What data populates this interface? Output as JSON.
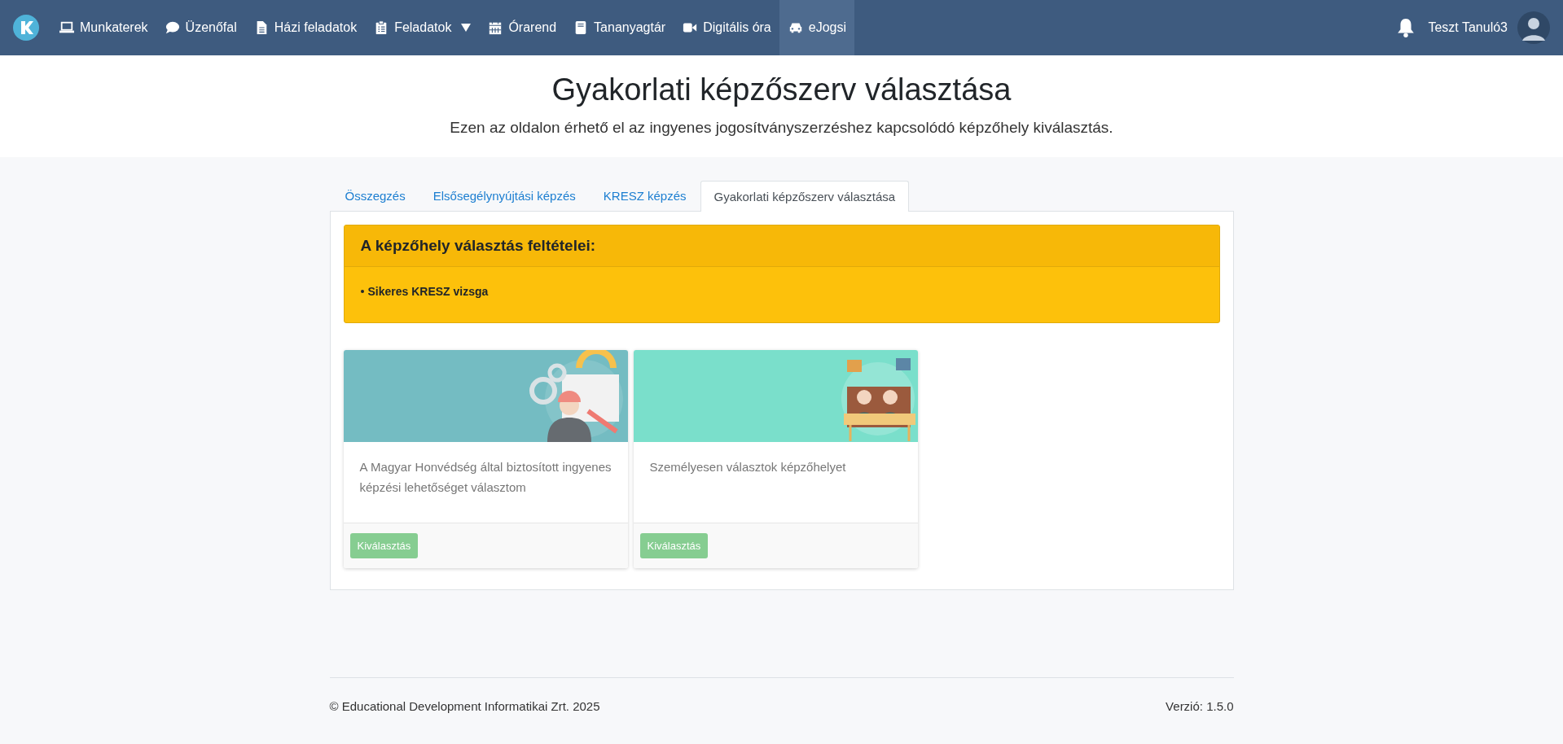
{
  "nav": {
    "items": [
      {
        "label": "Munkaterek",
        "selected": false
      },
      {
        "label": "Üzenőfal",
        "selected": false
      },
      {
        "label": "Házi feladatok",
        "selected": false
      },
      {
        "label": "Feladatok",
        "selected": false,
        "dropdown": true
      },
      {
        "label": "Órarend",
        "selected": false
      },
      {
        "label": "Tananyagtár",
        "selected": false
      },
      {
        "label": "Digitális óra",
        "selected": false
      },
      {
        "label": "eJogsi",
        "selected": true
      }
    ],
    "user": "Teszt Tanuló3"
  },
  "header": {
    "title": "Gyakorlati képzőszerv választása",
    "subtitle": "Ezen az oldalon érhető el az ingyenes jogosítványszerzéshez kapcsolódó képzőhely kiválasztás."
  },
  "tabs": [
    {
      "label": "Összegzés",
      "selected": false
    },
    {
      "label": "Elsősegélynyújtási képzés",
      "selected": false
    },
    {
      "label": "KRESZ képzés",
      "selected": false
    },
    {
      "label": "Gyakorlati képzőszerv választása",
      "selected": true
    }
  ],
  "conditions": {
    "title": "A képzőhely választás feltételei:",
    "items": [
      "Sikeres KRESZ vizsga"
    ]
  },
  "cards": [
    {
      "kind": "picture",
      "text": "A Magyar Honvédség által biztosított ingyenes képzési lehetőséget választom",
      "button": "Kiválasztás",
      "disabled": true
    },
    {
      "kind": "picture",
      "text": "Személyesen választok képzőhelyet",
      "button": "Kiválasztás",
      "disabled": true
    }
  ],
  "footer": {
    "copyright": "© Educational Development Informatikai Zrt. 2025",
    "version": "Verzió: 1.5.0"
  }
}
